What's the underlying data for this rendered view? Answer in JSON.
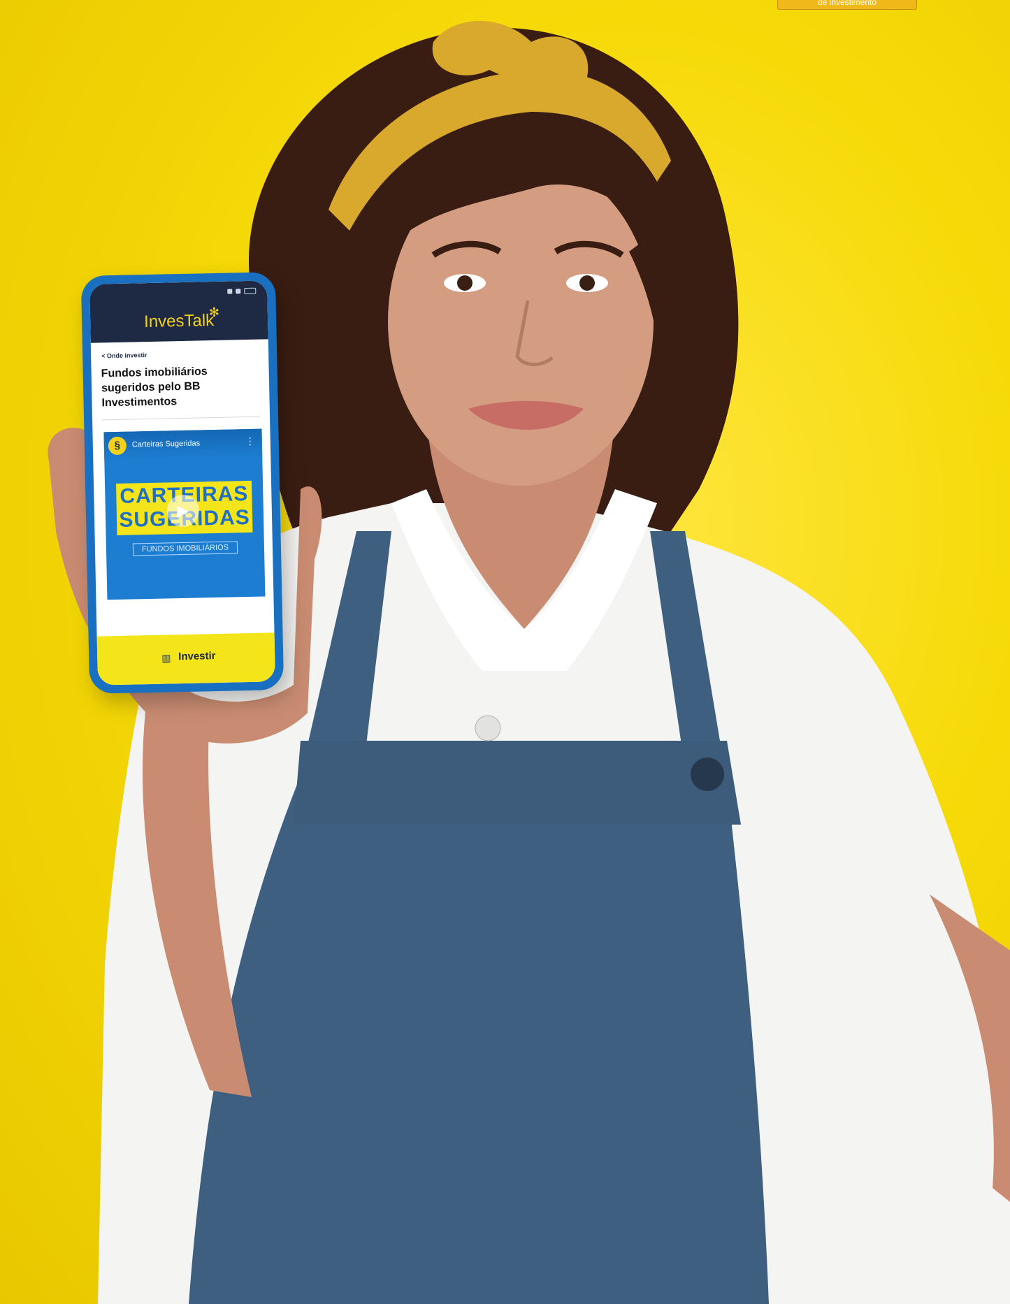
{
  "corner_badge": {
    "text": "de investimento"
  },
  "phone": {
    "app_title": "InvesTalk",
    "breadcrumb": "< Onde investir",
    "article_title": "Fundos imobiliários sugeridos pelo BB Investimentos",
    "video": {
      "channel_name": "Carteiras Sugeridas",
      "headline_line1": "CARTEIRAS",
      "headline_line2": "SUGERIDAS",
      "subtitle": "FUNDOS IMOBILIÁRIOS"
    },
    "bottom_nav": {
      "label": "Investir"
    }
  },
  "colors": {
    "background": "#f8de0a",
    "phone_case": "#1a70c0",
    "app_header": "#1e2a44",
    "brand_yellow": "#f4d21b",
    "video_blue": "#1d7dd1",
    "apron": "#3f5f80",
    "shirt": "#f4f4f2",
    "hair": "#3a1d12",
    "headband": "#d9a92e"
  },
  "icons": [
    "play-icon",
    "kebab-menu-icon",
    "chart-invest-icon",
    "bb-logo-icon",
    "signal-icon",
    "battery-icon"
  ]
}
